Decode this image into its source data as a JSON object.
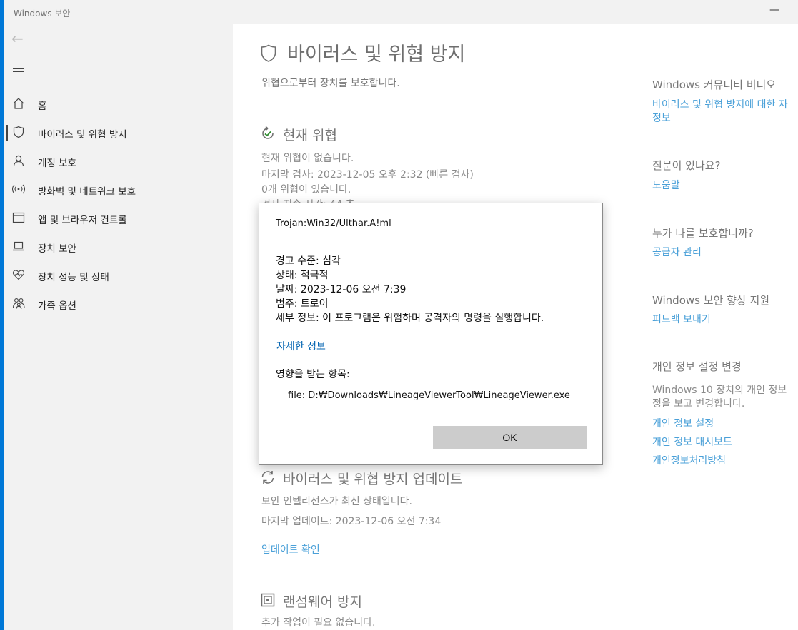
{
  "window": {
    "title": "Windows 보안",
    "minimize_glyph": "—"
  },
  "sidebar": {
    "back_icon": "←",
    "items": [
      {
        "label": "홈",
        "icon": "home-icon"
      },
      {
        "label": "바이러스 및 위협 방지",
        "icon": "shield-icon",
        "selected": true
      },
      {
        "label": "계정 보호",
        "icon": "person-icon"
      },
      {
        "label": "방화벽 및 네트워크 보호",
        "icon": "wireless-icon"
      },
      {
        "label": "앱 및 브라우저 컨트롤",
        "icon": "browser-icon"
      },
      {
        "label": "장치 보안",
        "icon": "laptop-icon"
      },
      {
        "label": "장치 성능 및 상태",
        "icon": "heart-icon"
      },
      {
        "label": "가족 옵션",
        "icon": "family-icon"
      }
    ]
  },
  "main": {
    "title": "바이러스 및 위협 방지",
    "subtitle": "위협으로부터 장치를 보호합니다.",
    "current_threats": {
      "title": "현재 위협",
      "line1": "현재 위협이 없습니다.",
      "line2": "마지막 검사: 2023-12-05 오후 2:32 (빠른 검사)",
      "line3": "0개 위협이 있습니다.",
      "line4": "검사 지속 시간: 44 초"
    },
    "updates": {
      "title": "바이러스 및 위협 방지 업데이트",
      "line1": "보안 인텔리전스가 최신 상태입니다.",
      "line2": "마지막 업데이트: 2023-12-06 오전 7:34",
      "link": "업데이트 확인"
    },
    "ransomware": {
      "title": "랜섬웨어 방지",
      "line1": "추가 작업이 필요 없습니다."
    }
  },
  "right_panel": {
    "community_title": "Windows 커뮤니티 비디오",
    "community_link1": "바이러스 및 위협 방지에 대한 자",
    "community_link2": "정보",
    "question_title": "질문이 있나요?",
    "help_link": "도움말",
    "protect_title": "누가 나를 보호합니까?",
    "provider_link": "공급자 관리",
    "improve_title": "Windows 보안 향상 지원",
    "feedback_link": "피드백 보내기",
    "privacy_title": "개인 정보 설정 변경",
    "privacy_text1": "Windows 10 장치의 개인 정보",
    "privacy_text2": "정을 보고 변경합니다.",
    "privacy_link1": "개인 정보 설정",
    "privacy_link2": "개인 정보 대시보드",
    "privacy_link3": "개인정보처리방침"
  },
  "dialog": {
    "threat_name": "Trojan:Win32/Ulthar.A!ml",
    "alert_level": "경고 수준: 심각",
    "status": "상태: 적극적",
    "date": "날짜: 2023-12-06 오전 7:39",
    "category": "범주: 트로이",
    "details": "세부 정보: 이 프로그램은 위험하며 공격자의 명령을 실행합니다.",
    "more_info": "자세한 정보",
    "affected_label": "영향을 받는 항목:",
    "affected_file": "file: D:₩Downloads₩LineageViewerTool₩LineageViewer.exe",
    "ok_label": "OK"
  },
  "colors": {
    "accent": "#0078d7",
    "link": "#4aa0d8",
    "dialog_link": "#0063b1",
    "sidebar_bg": "#f2f2f2",
    "button_bg": "#cccccc"
  }
}
